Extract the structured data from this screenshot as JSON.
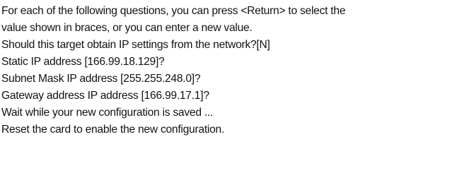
{
  "console": {
    "lines": [
      "For each of the following questions, you can press <Return> to select the",
      "value shown in braces, or you can enter a new value.",
      "Should this target obtain IP settings from the network?[N]",
      "Static IP address [166.99.18.129]?",
      "Subnet Mask IP address [255.255.248.0]?",
      "Gateway address IP address [166.99.17.1]?",
      "Wait while your new configuration is saved ...",
      "Reset the card to enable the new configuration."
    ]
  }
}
